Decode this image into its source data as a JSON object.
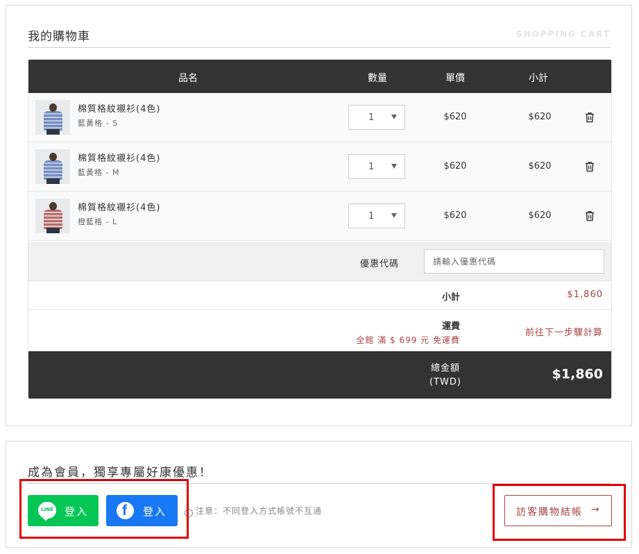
{
  "cart": {
    "title": "我的購物車",
    "subtitle": "SHOPPING CART",
    "columns": {
      "name": "品名",
      "qty": "數量",
      "price": "單價",
      "subtotal": "小計"
    },
    "items": [
      {
        "name": "棉質格紋襯衫(4色)",
        "variant": "藍黃格 - S",
        "qty": "1",
        "price": "$620",
        "subtotal": "$620"
      },
      {
        "name": "棉質格紋襯衫(4色)",
        "variant": "藍黃格 - M",
        "qty": "1",
        "price": "$620",
        "subtotal": "$620"
      },
      {
        "name": "棉質格紋襯衫(4色)",
        "variant": "橙藍格 - L",
        "qty": "1",
        "price": "$620",
        "subtotal": "$620"
      }
    ],
    "coupon": {
      "label": "優惠代碼",
      "placeholder": "請輸入優惠代碼"
    },
    "summary": {
      "subtotal_label": "小計",
      "subtotal_value": "$1,860",
      "shipping_label": "運費",
      "shipping_note": "全館 滿 $ 699 元 免運費",
      "shipping_value": "前往下一步驟計算",
      "total_label": "總金額",
      "total_currency": "(TWD)",
      "total_value": "$1,860"
    }
  },
  "member": {
    "title": "成為會員，獨享專屬好康優惠！",
    "line_login": {
      "logo": "LINE",
      "label": "登入"
    },
    "fb_login": {
      "logo": "f",
      "label": "登入"
    },
    "note_icon": "!",
    "note": "注意：不同登入方式帳號不互通",
    "guest_checkout": "訪客購物結帳",
    "guest_arrow": "→"
  },
  "colors": {
    "accent": "#a84343",
    "dark": "#333333",
    "line": "#06c755",
    "facebook": "#1877f2",
    "highlight": "#e00000"
  }
}
